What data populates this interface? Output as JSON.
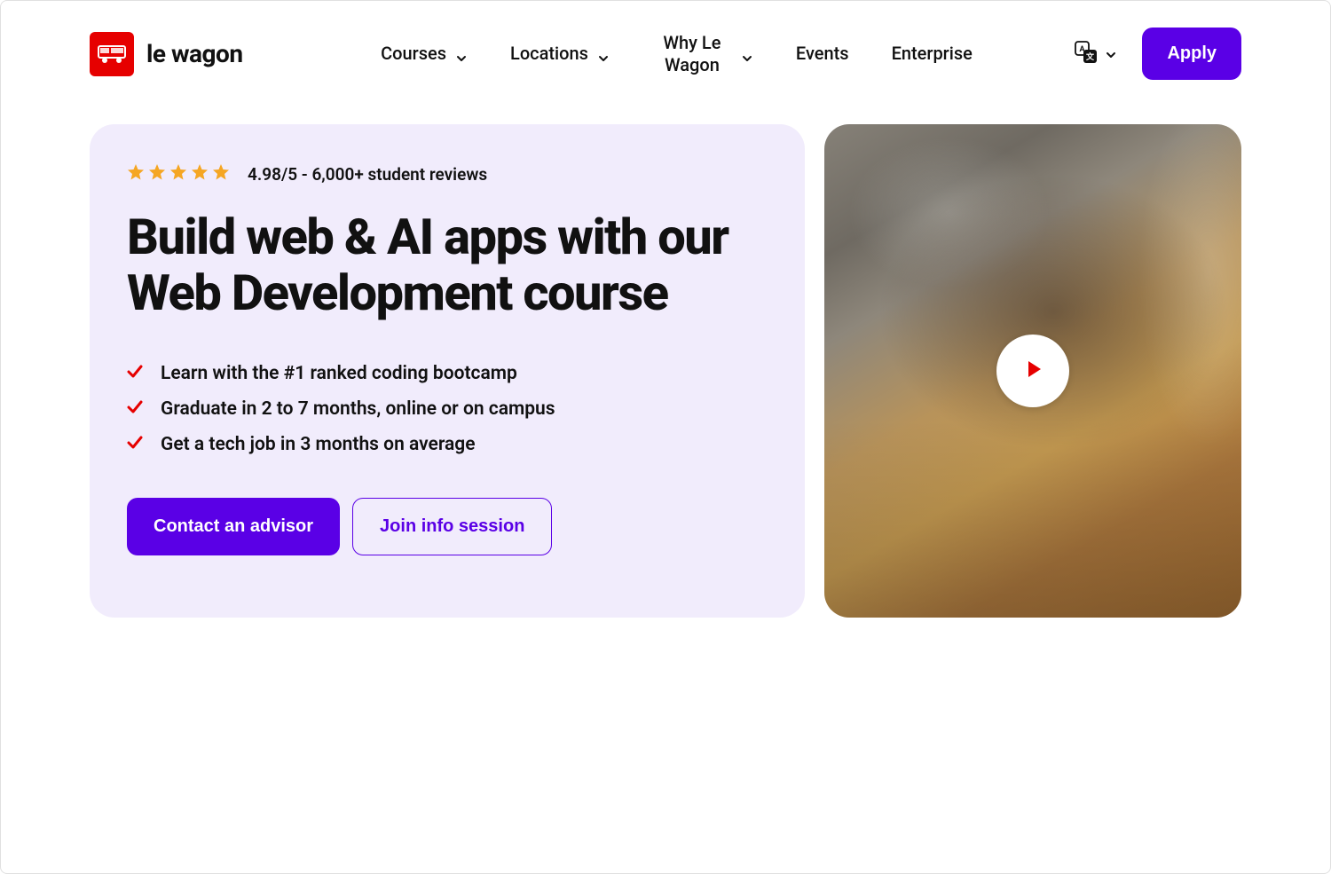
{
  "brand": {
    "name": "le wagon"
  },
  "nav": {
    "items": [
      {
        "label": "Courses",
        "hasDropdown": true
      },
      {
        "label": "Locations",
        "hasDropdown": true
      },
      {
        "label": "Why Le Wagon",
        "hasDropdown": true
      },
      {
        "label": "Events",
        "hasDropdown": false
      },
      {
        "label": "Enterprise",
        "hasDropdown": false
      }
    ],
    "apply_label": "Apply"
  },
  "hero": {
    "rating_text": "4.98/5 - 6,000+ student reviews",
    "stars": 5,
    "title": "Build web & AI apps with our Web Development course",
    "features": [
      "Learn with the #1 ranked coding bootcamp",
      "Graduate in 2 to 7 months, online or on campus",
      "Get a tech job in 3 months on average"
    ],
    "cta_primary": "Contact an advisor",
    "cta_secondary": "Join info session"
  },
  "colors": {
    "accent": "#5a00e6",
    "brand_red": "#e60000",
    "star": "#f5a623",
    "check": "#e60000"
  }
}
